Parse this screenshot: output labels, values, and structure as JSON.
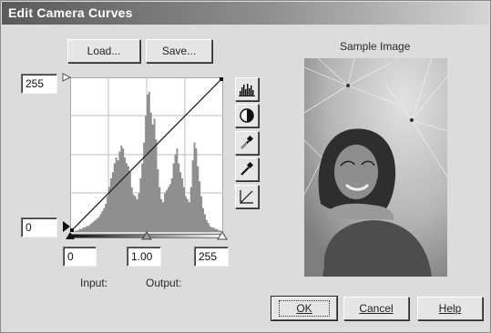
{
  "window": {
    "title": "Edit Camera Curves"
  },
  "top_buttons": {
    "load_label": "Load...",
    "save_label": "Save..."
  },
  "sample": {
    "label": "Sample Image"
  },
  "levels": {
    "output_max": "255",
    "output_min": "0",
    "input_black": "0",
    "gamma": "1.00",
    "input_white": "255"
  },
  "labels": {
    "input": "Input:",
    "output": "Output:"
  },
  "tools": [
    "histogram-icon",
    "contrast-icon",
    "black-point-eyedropper-icon",
    "white-point-eyedropper-icon",
    "reset-curve-icon"
  ],
  "histogram": [
    0,
    0,
    0,
    1,
    1,
    2,
    2,
    3,
    3,
    4,
    4,
    5,
    6,
    7,
    8,
    9,
    10,
    12,
    14,
    16,
    19,
    24,
    30,
    36,
    40,
    46,
    50,
    48,
    54,
    58,
    56,
    50,
    46,
    44,
    40,
    30,
    25,
    24,
    22,
    26,
    36,
    46,
    60,
    78,
    92,
    94,
    80,
    72,
    76,
    62,
    42,
    30,
    22,
    20,
    26,
    28,
    30,
    32,
    36,
    46,
    52,
    56,
    46,
    40,
    36,
    30,
    24,
    22,
    20,
    30,
    48,
    60,
    56,
    44,
    34,
    24,
    16,
    12,
    8,
    6,
    4,
    3,
    3,
    2,
    2,
    1,
    1,
    0
  ],
  "footer": {
    "ok_label": "OK",
    "cancel_label": "Cancel",
    "help_label": "Help"
  }
}
